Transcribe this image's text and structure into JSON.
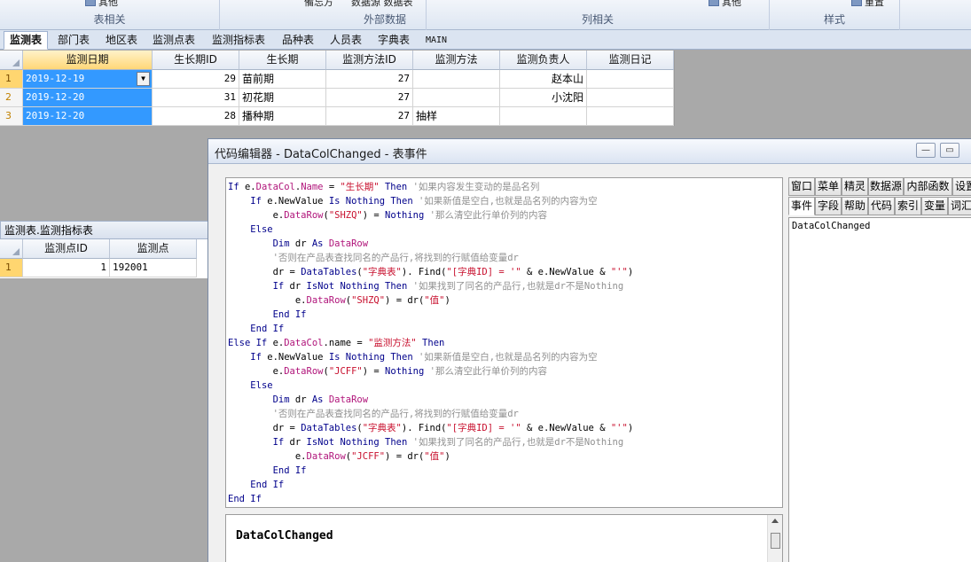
{
  "ribbon": {
    "groups": [
      {
        "label": "表相关",
        "button": "其他"
      },
      {
        "label": "外部数据",
        "button": "数据源 数据表"
      },
      {
        "label": "列相关",
        "button": "其他"
      },
      {
        "label": "样式",
        "button": "重置"
      }
    ],
    "misc_button": "備忘方"
  },
  "tabs": [
    "监测表",
    "部门表",
    "地区表",
    "监测点表",
    "监测指标表",
    "品种表",
    "人员表",
    "字典表",
    "MAIN"
  ],
  "main_table": {
    "columns": [
      "监测日期",
      "生长期ID",
      "生长期",
      "监测方法ID",
      "监测方法",
      "监测负责人",
      "监测日记"
    ],
    "rows": [
      {
        "num": "1",
        "date": "2019-12-19",
        "stage_id": "29",
        "stage": "苗前期",
        "method_id": "27",
        "method": "",
        "owner": "赵本山",
        "log": ""
      },
      {
        "num": "2",
        "date": "2019-12-20",
        "stage_id": "31",
        "stage": "初花期",
        "method_id": "27",
        "method": "",
        "owner": "小沈阳",
        "log": ""
      },
      {
        "num": "3",
        "date": "2019-12-20",
        "stage_id": "28",
        "stage": "播种期",
        "method_id": "27",
        "method": "抽样",
        "owner": "",
        "log": ""
      }
    ]
  },
  "sub_table": {
    "caption": "监测表.监测指标表",
    "columns": [
      "监测点ID",
      "监测点"
    ],
    "rows": [
      {
        "num": "1",
        "point_id": "1",
        "point": "192001"
      }
    ]
  },
  "editor": {
    "title": "代码编辑器 - DataColChanged - 表事件",
    "min": "▭",
    "max": "▢",
    "code": [
      [
        [
          "kw",
          "If "
        ],
        [
          "",
          "e."
        ],
        [
          "pr",
          "DataCol"
        ],
        [
          "",
          "."
        ],
        [
          "pr",
          "Name"
        ],
        [
          "",
          " = "
        ],
        [
          "st",
          "\"生长期\""
        ],
        [
          "kw",
          " Then"
        ],
        [
          "cm",
          " '如果内容发生变动的是品名列"
        ]
      ],
      [
        [
          "",
          "    "
        ],
        [
          "kw",
          "If "
        ],
        [
          "",
          "e.NewValue "
        ],
        [
          "kw",
          "Is Nothing Then"
        ],
        [
          "cm",
          " '如果新值是空白,也就是品名列的内容为空"
        ]
      ],
      [
        [
          "",
          "        e."
        ],
        [
          "pr",
          "DataRow"
        ],
        [
          "",
          "("
        ],
        [
          "st",
          "\"SHZQ\""
        ],
        [
          "",
          ") = "
        ],
        [
          "kw",
          "Nothing"
        ],
        [
          "cm",
          " '那么清空此行单价列的内容"
        ]
      ],
      [
        [
          "",
          "    "
        ],
        [
          "kw",
          "Else"
        ]
      ],
      [
        [
          "",
          "        "
        ],
        [
          "kw",
          "Dim "
        ],
        [
          "",
          "dr "
        ],
        [
          "kw",
          "As "
        ],
        [
          "pr",
          "DataRow"
        ]
      ],
      [
        [
          "",
          "        "
        ],
        [
          "cm",
          "'否则在产品表查找同名的产品行,将找到的行赋值给变量dr"
        ]
      ],
      [
        [
          "",
          "        dr = "
        ],
        [
          "kw",
          "DataTables"
        ],
        [
          "",
          "("
        ],
        [
          "st",
          "\"字典表\""
        ],
        [
          "",
          "). Find("
        ],
        [
          "st",
          "\"[字典ID] = '\""
        ],
        [
          "",
          " & e.NewValue & "
        ],
        [
          "st",
          "\"'\""
        ],
        [
          "",
          ")"
        ]
      ],
      [
        [
          "",
          "        "
        ],
        [
          "kw",
          "If "
        ],
        [
          "",
          "dr "
        ],
        [
          "kw",
          "IsNot Nothing Then"
        ],
        [
          "cm",
          " '如果找到了同名的产品行,也就是dr不是Nothing"
        ]
      ],
      [
        [
          "",
          "            e."
        ],
        [
          "pr",
          "DataRow"
        ],
        [
          "",
          "("
        ],
        [
          "st",
          "\"SHZQ\""
        ],
        [
          "",
          ") = dr("
        ],
        [
          "st",
          "\"值\""
        ],
        [
          "",
          ")"
        ]
      ],
      [
        [
          "",
          "        "
        ],
        [
          "kw",
          "End If"
        ]
      ],
      [
        [
          "",
          "    "
        ],
        [
          "kw",
          "End If"
        ]
      ],
      [
        [
          "kw",
          "Else If "
        ],
        [
          "",
          "e."
        ],
        [
          "pr",
          "DataCol"
        ],
        [
          "",
          ".name = "
        ],
        [
          "st",
          "\"监测方法\""
        ],
        [
          "kw",
          " Then"
        ]
      ],
      [
        [
          "",
          "    "
        ],
        [
          "kw",
          "If "
        ],
        [
          "",
          "e.NewValue "
        ],
        [
          "kw",
          "Is Nothing Then"
        ],
        [
          "cm",
          " '如果新值是空白,也就是品名列的内容为空"
        ]
      ],
      [
        [
          "",
          "        e."
        ],
        [
          "pr",
          "DataRow"
        ],
        [
          "",
          "("
        ],
        [
          "st",
          "\"JCFF\""
        ],
        [
          "",
          ") = "
        ],
        [
          "kw",
          "Nothing"
        ],
        [
          "cm",
          " '那么清空此行单价列的内容"
        ]
      ],
      [
        [
          "",
          "    "
        ],
        [
          "kw",
          "Else"
        ]
      ],
      [
        [
          "",
          "        "
        ],
        [
          "kw",
          "Dim "
        ],
        [
          "",
          "dr "
        ],
        [
          "kw",
          "As "
        ],
        [
          "pr",
          "DataRow"
        ]
      ],
      [
        [
          "",
          "        "
        ],
        [
          "cm",
          "'否则在产品表查找同名的产品行,将找到的行赋值给变量dr"
        ]
      ],
      [
        [
          "",
          "        dr = "
        ],
        [
          "kw",
          "DataTables"
        ],
        [
          "",
          "("
        ],
        [
          "st",
          "\"字典表\""
        ],
        [
          "",
          "). Find("
        ],
        [
          "st",
          "\"[字典ID] = '\""
        ],
        [
          "",
          " & e.NewValue & "
        ],
        [
          "st",
          "\"'\""
        ],
        [
          "",
          ")"
        ]
      ],
      [
        [
          "",
          "        "
        ],
        [
          "kw",
          "If "
        ],
        [
          "",
          "dr "
        ],
        [
          "kw",
          "IsNot Nothing Then"
        ],
        [
          "cm",
          " '如果找到了同名的产品行,也就是dr不是Nothing"
        ]
      ],
      [
        [
          "",
          "            e."
        ],
        [
          "pr",
          "DataRow"
        ],
        [
          "",
          "("
        ],
        [
          "st",
          "\"JCFF\""
        ],
        [
          "",
          ") = dr("
        ],
        [
          "st",
          "\"值\""
        ],
        [
          "",
          ")"
        ]
      ],
      [
        [
          "",
          "        "
        ],
        [
          "kw",
          "End If"
        ]
      ],
      [
        [
          "",
          "    "
        ],
        [
          "kw",
          "End If"
        ]
      ],
      [
        [
          "kw",
          "End If"
        ]
      ]
    ],
    "help_title": "DataColChanged",
    "side_tabs_row1": [
      "窗口",
      "菜单",
      "精灵",
      "数据源",
      "内部函数",
      "设置"
    ],
    "side_tabs_row2": [
      "事件",
      "字段",
      "帮助",
      "代码",
      "索引",
      "变量",
      "词汇"
    ],
    "side_list": [
      "DataColChanged"
    ]
  }
}
